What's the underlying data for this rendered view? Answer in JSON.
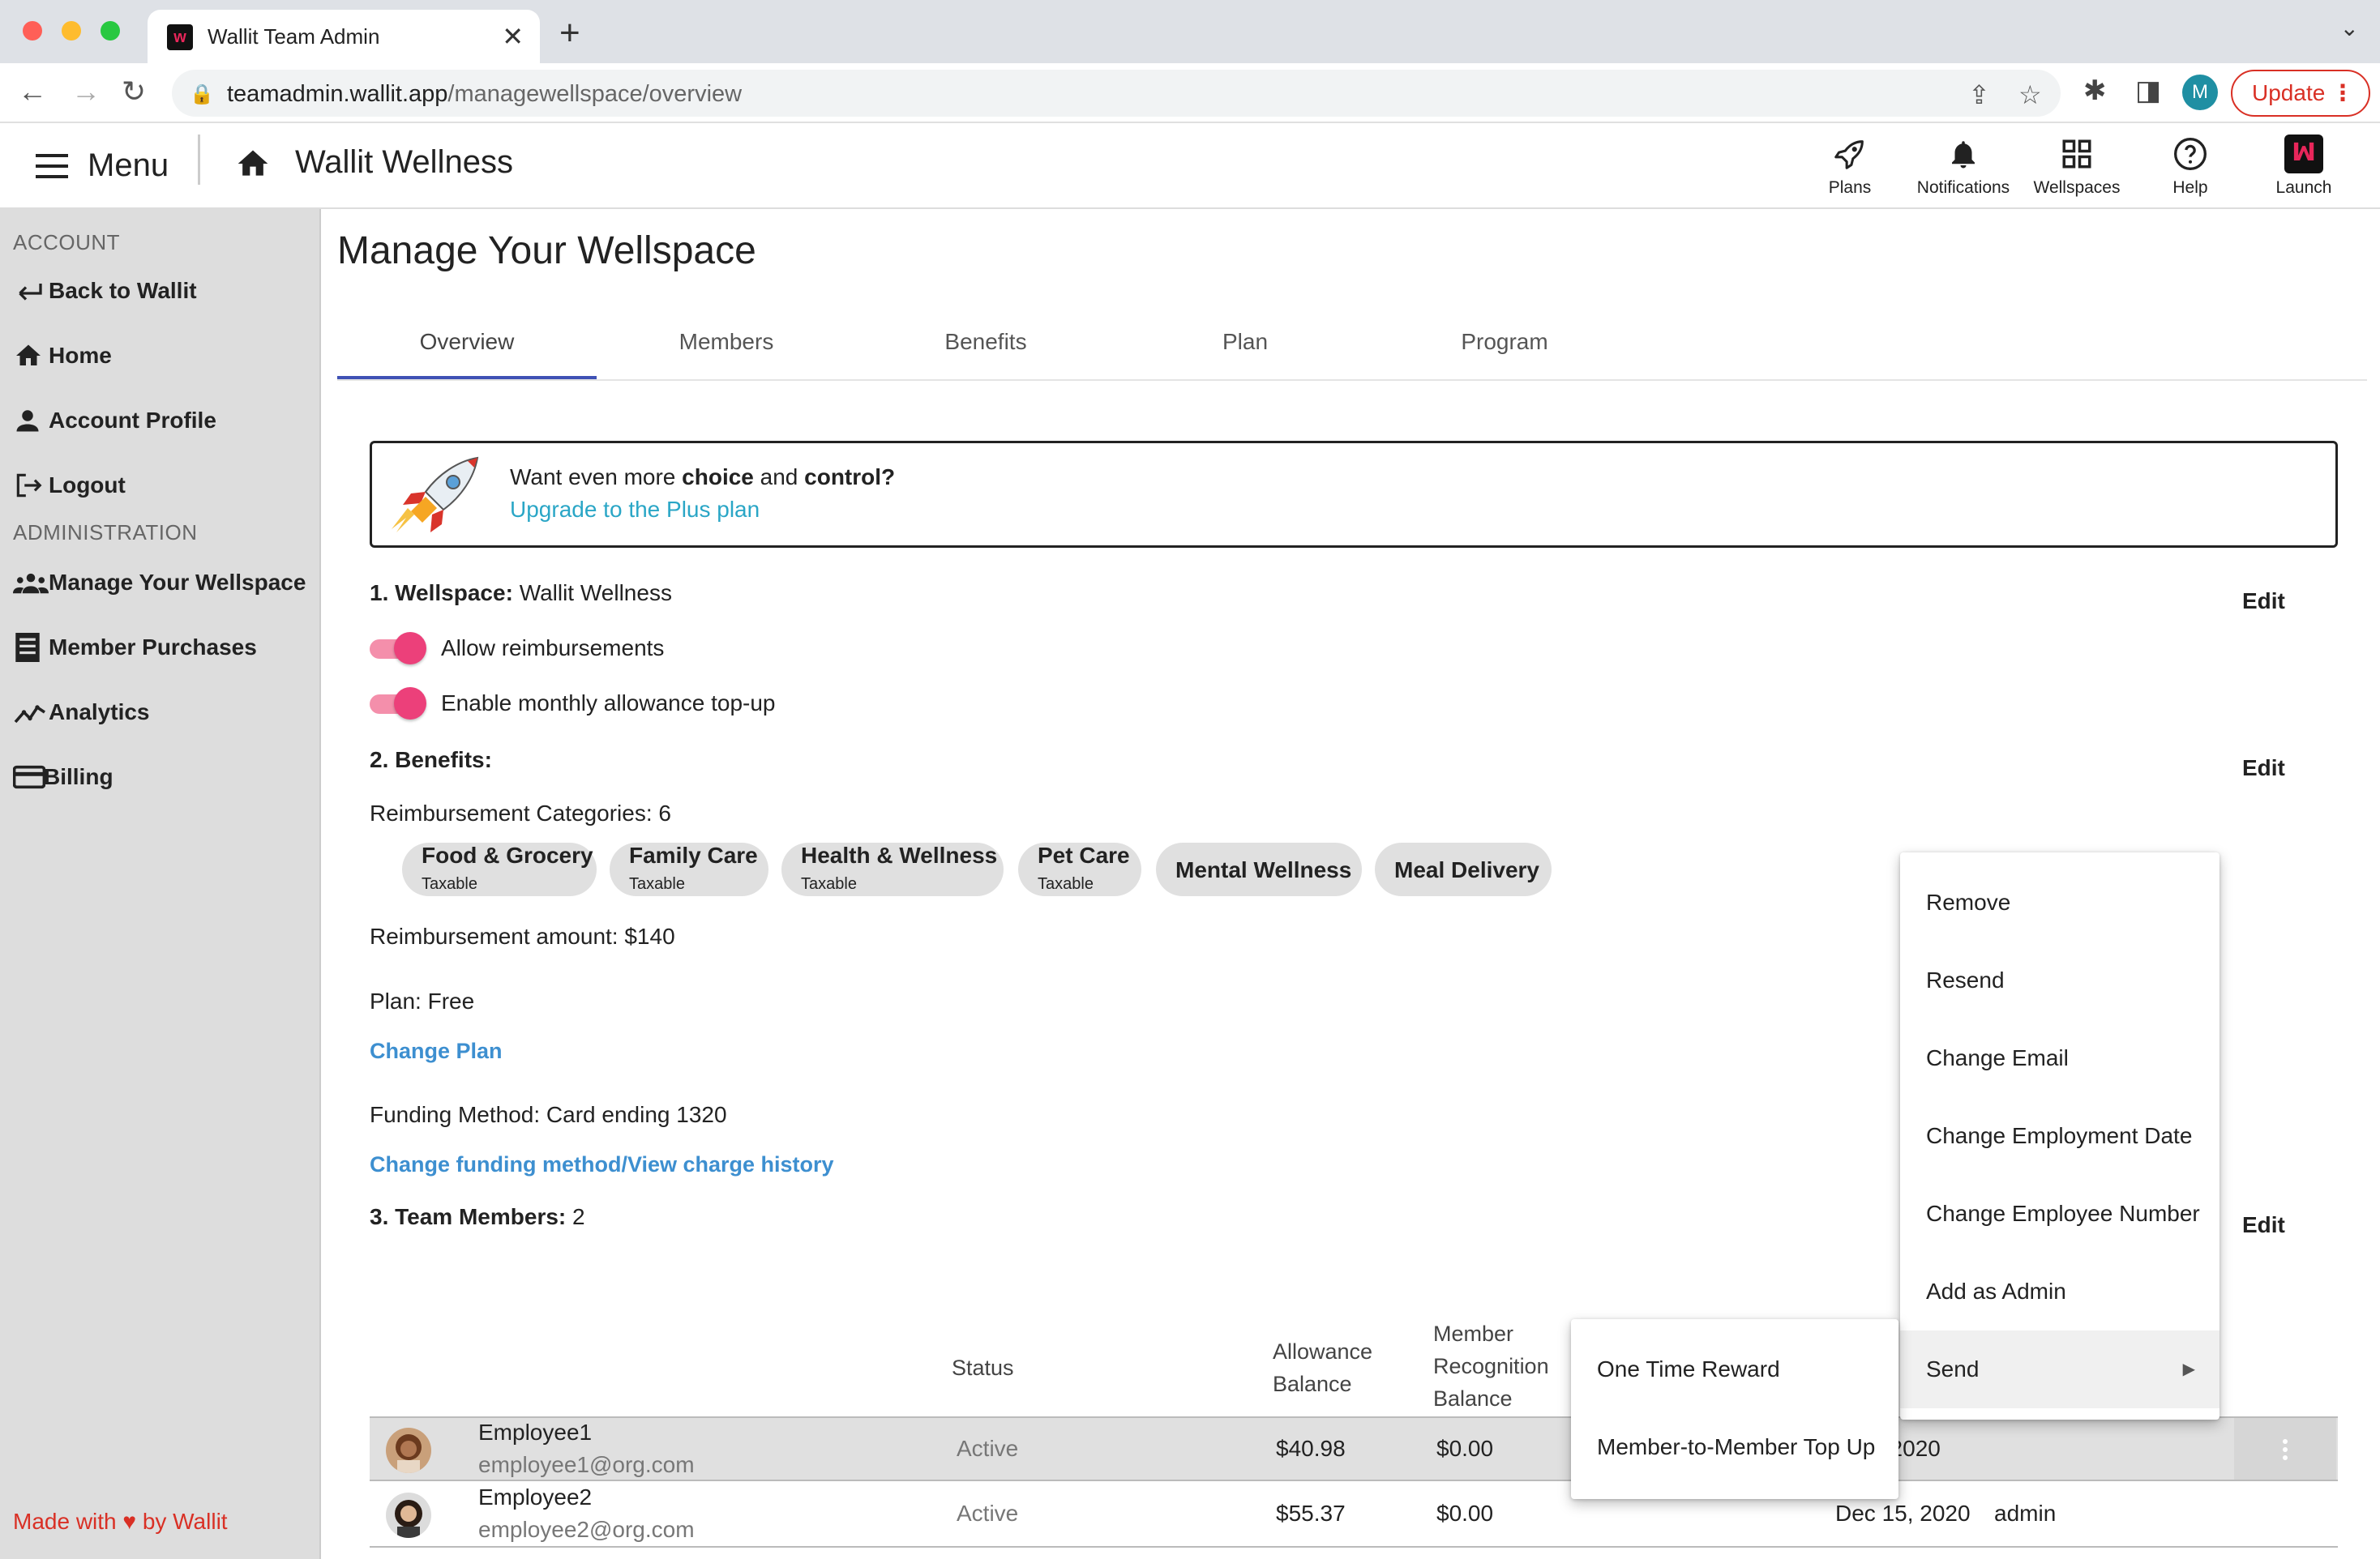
{
  "browser": {
    "tab_title": "Wallit Team Admin",
    "url_host": "teamadmin.wallit.app",
    "url_path": "/managewellspace/overview",
    "profile_initial": "M",
    "update_label": "Update"
  },
  "header": {
    "menu_label": "Menu",
    "app_title": "Wallit Wellness",
    "items": [
      {
        "label": "Plans",
        "icon": "rocket-icon"
      },
      {
        "label": "Notifications",
        "icon": "bell-icon"
      },
      {
        "label": "Wellspaces",
        "icon": "grid-icon"
      },
      {
        "label": "Help",
        "icon": "help-circle-icon"
      },
      {
        "label": "Launch",
        "icon": "wallit-logo-icon"
      }
    ]
  },
  "sidebar": {
    "account_heading": "ACCOUNT",
    "admin_heading": "ADMINISTRATION",
    "account_items": [
      {
        "label": "Back to Wallit",
        "icon": "back-arrow-icon"
      },
      {
        "label": "Home",
        "icon": "home-icon"
      },
      {
        "label": "Account Profile",
        "icon": "person-icon"
      },
      {
        "label": "Logout",
        "icon": "logout-icon"
      }
    ],
    "admin_items": [
      {
        "label": "Manage Your Wellspace",
        "icon": "people-icon"
      },
      {
        "label": "Member Purchases",
        "icon": "receipt-icon"
      },
      {
        "label": "Analytics",
        "icon": "analytics-icon"
      },
      {
        "label": "Billing",
        "icon": "credit-card-icon"
      }
    ],
    "footer_prefix": "Made with",
    "footer_suffix": "by Wallit"
  },
  "main": {
    "page_title": "Manage Your Wellspace",
    "tabs": [
      "Overview",
      "Members",
      "Benefits",
      "Plan",
      "Program"
    ],
    "active_tab": "Overview",
    "banner": {
      "text_1": "Want even more ",
      "bold_1": "choice",
      "text_2": " and ",
      "bold_2": "control?",
      "link": "Upgrade to the Plus plan"
    },
    "wellspace": {
      "label": "1. Wellspace:",
      "value": "Wallit Wellness",
      "edit": "Edit",
      "toggles": [
        {
          "label": "Allow reimbursements",
          "on": true
        },
        {
          "label": "Enable monthly allowance top-up",
          "on": true
        }
      ]
    },
    "benefits": {
      "label": "2. Benefits:",
      "edit": "Edit",
      "categories_text": "Reimbursement Categories: 6",
      "chips": [
        {
          "name": "Food & Grocery",
          "tag": "Taxable"
        },
        {
          "name": "Family Care",
          "tag": "Taxable"
        },
        {
          "name": "Health & Wellness",
          "tag": "Taxable"
        },
        {
          "name": "Pet Care",
          "tag": "Taxable"
        },
        {
          "name": "Mental Wellness",
          "tag": ""
        },
        {
          "name": "Meal Delivery",
          "tag": ""
        }
      ],
      "amount_text": "Reimbursement amount: $140",
      "plan_text": "Plan: Free",
      "change_plan": "Change Plan",
      "funding_text": "Funding Method: Card ending 1320",
      "change_funding": "Change funding method/View charge history"
    },
    "team": {
      "label": "3. Team Members:",
      "count": "2",
      "edit": "Edit",
      "columns": {
        "status": "Status",
        "allowance_1": "Allowance",
        "allowance_2": "Balance",
        "recog_1": "Member",
        "recog_2": "Recognition",
        "recog_3": "Balance"
      },
      "rows": [
        {
          "name": "Employee1",
          "email": "employee1@org.com",
          "status": "Active",
          "allowance": "$40.98",
          "recognition": "$0.00",
          "date": ", 2020",
          "role": ""
        },
        {
          "name": "Employee2",
          "email": "employee2@org.com",
          "status": "Active",
          "allowance": "$55.37",
          "recognition": "$0.00",
          "date": "Dec 15, 2020",
          "role": "admin"
        }
      ]
    }
  },
  "context_menu": {
    "items": [
      "Remove",
      "Resend",
      "Change Email",
      "Change Employment Date",
      "Change Employee Number",
      "Add as Admin",
      "Send"
    ],
    "submenu": [
      "One Time Reward",
      "Member-to-Member Top Up"
    ]
  },
  "colors": {
    "accent_pink": "#ec407a",
    "link_blue": "#3d8fd0",
    "tab_indicator": "#3f51b5",
    "update_red": "#d93025"
  }
}
